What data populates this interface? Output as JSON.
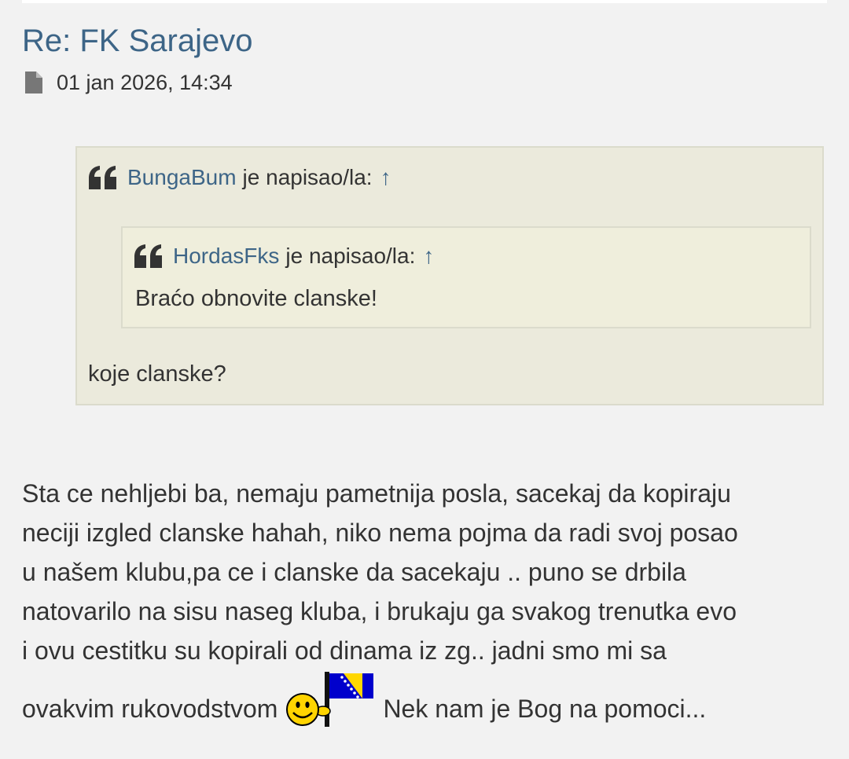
{
  "post": {
    "title": "Re: FK Sarajevo",
    "date": "01 jan 2026, 14:34",
    "icon": "file-icon"
  },
  "quote_outer": {
    "author": "BungaBum",
    "wrote_label": "je napisao/la:",
    "jump_arrow": "↑",
    "text": "koje clanske?",
    "inner": {
      "author": "HordasFks",
      "wrote_label": "je napisao/la:",
      "jump_arrow": "↑",
      "text": "Braćo obnovite clanske!"
    }
  },
  "body": {
    "lines": [
      "Sta ce nehljebi ba, nemaju pametnija posla, sacekaj da kopiraju",
      "neciji izgled clanske hahah, niko nema pojma da radi svoj posao",
      "u našem klubu,pa ce i clanske da sacekaju .. puno se drbila",
      "natovarilo na sisu naseg kluba, i brukaju ga svakog trenutka evo",
      "i ovu cestitku su kopirali od dinama iz zg.. jadni smo mi sa"
    ],
    "last_before": "ovakvim rukovodstvom",
    "last_after": "Nek nam je Bog na pomoci...",
    "smiley": "bosnia-flag-smiley-icon"
  },
  "colors": {
    "link": "#3d6587",
    "text": "#333333",
    "background": "#f2f2f2",
    "quote_bg": "#ebeadc",
    "quote_inner_bg": "#efeedc",
    "quote_border": "#dbdbcc",
    "flag_blue": "#0000cc",
    "flag_yellow": "#ffd700"
  }
}
